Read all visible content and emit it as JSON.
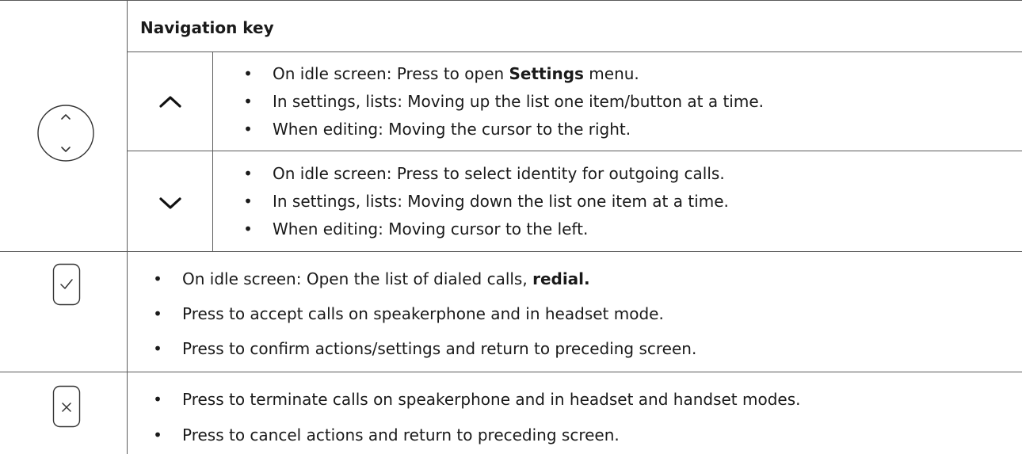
{
  "header": {
    "title": "Navigation key"
  },
  "nav_key": {
    "up": {
      "icon": "chevron-up-icon",
      "items": [
        {
          "text": "On idle screen:  Press to open ",
          "bold": "Settings",
          "after": " menu."
        },
        {
          "text": "In settings, lists:  Moving up the list one item/button at a time.",
          "bold": "",
          "after": ""
        },
        {
          "text": "When editing:  Moving the cursor to the right.",
          "bold": "",
          "after": ""
        }
      ]
    },
    "down": {
      "icon": "chevron-down-icon",
      "items": [
        {
          "text": "On idle screen:  Press to select identity for outgoing calls.",
          "bold": "",
          "after": ""
        },
        {
          "text": "In settings, lists:  Moving down the list one item at a time.",
          "bold": "",
          "after": ""
        },
        {
          "text": "When editing:  Moving cursor to the left.",
          "bold": "",
          "after": ""
        }
      ]
    }
  },
  "accept_key": {
    "icon": "check-key-icon",
    "items": [
      {
        "text": "On idle screen:  Open the list of dialed calls, ",
        "bold": "redial.",
        "after": ""
      },
      {
        "text": "Press to accept calls on speakerphone and in headset mode.",
        "bold": "",
        "after": ""
      },
      {
        "text": "Press to confirm actions/settings and return to preceding screen.",
        "bold": "",
        "after": ""
      }
    ]
  },
  "cancel_key": {
    "icon": "cancel-key-icon",
    "items": [
      {
        "text": "Press to terminate calls on speakerphone and in headset and handset modes.",
        "bold": "",
        "after": ""
      },
      {
        "text": "Press to cancel actions and return to preceding screen.",
        "bold": "",
        "after": ""
      }
    ]
  },
  "bullet_char": "•"
}
